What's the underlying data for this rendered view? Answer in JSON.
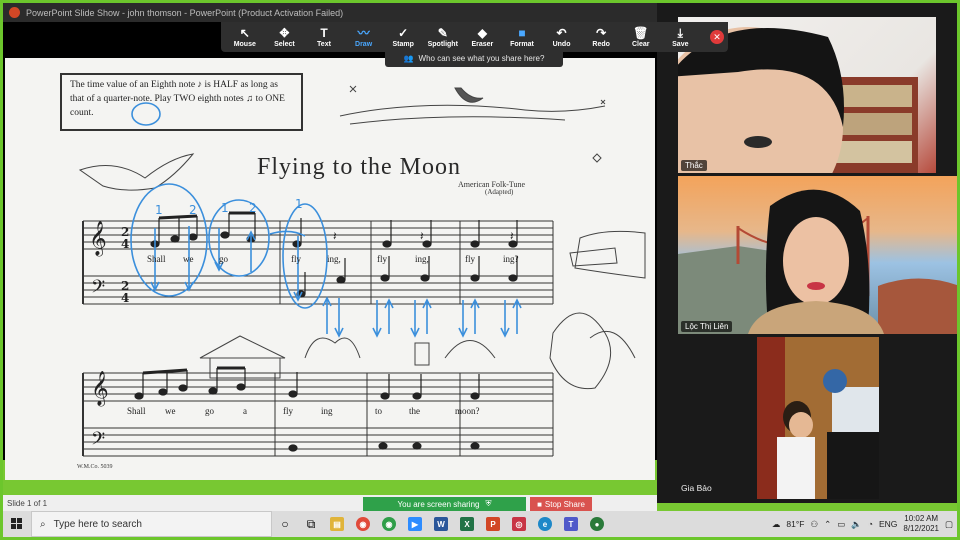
{
  "title_bar": {
    "text": "PowerPoint Slide Show  -  john thomson  -  PowerPoint (Product Activation Failed)"
  },
  "toolbar": {
    "items": [
      {
        "label": "Mouse",
        "icon": "cursor-icon",
        "glyph": "↖"
      },
      {
        "label": "Select",
        "icon": "move-icon",
        "glyph": "✥"
      },
      {
        "label": "Text",
        "icon": "text-icon",
        "glyph": "T"
      },
      {
        "label": "Draw",
        "icon": "draw-icon",
        "glyph": "〰",
        "active": true
      },
      {
        "label": "Stamp",
        "icon": "check-icon",
        "glyph": "✓"
      },
      {
        "label": "Spotlight",
        "icon": "spotlight-icon",
        "glyph": "✎"
      },
      {
        "label": "Eraser",
        "icon": "eraser-icon",
        "glyph": "◆"
      },
      {
        "label": "Format",
        "icon": "format-icon",
        "glyph": "■"
      },
      {
        "label": "Undo",
        "icon": "undo-icon",
        "glyph": "↶"
      },
      {
        "label": "Redo",
        "icon": "redo-icon",
        "glyph": "↷"
      },
      {
        "label": "Clear",
        "icon": "trash-icon",
        "glyph": "🗑"
      },
      {
        "label": "Save",
        "icon": "save-icon",
        "glyph": "⤓"
      }
    ],
    "close_glyph": "✕",
    "who_can_see": "Who can see what you share here?"
  },
  "slide": {
    "note_text": "The time value of an Eighth note ♪ is HALF as long as that of a quarter-note. Play TWO eighth notes ♫ to ONE count.",
    "music_title": "Flying to the Moon",
    "subtitle": "American Folk-Tune",
    "adapted": "(Adapted)",
    "lyrics_line1": [
      "Shall",
      "we",
      "go",
      "fly",
      "ing,",
      "fly",
      "ing,",
      "fly",
      "ing?"
    ],
    "lyrics_line2": [
      "Shall",
      "we",
      "go",
      "a",
      "fly",
      "ing",
      "to",
      "the",
      "moon?"
    ],
    "publisher": "W.M.Co. 5039"
  },
  "status": {
    "slide_count": "Slide 1 of 1",
    "sharing": "You are screen sharing",
    "stop_share": "Stop Share"
  },
  "participants": [
    {
      "name": "Thắc",
      "tile": "top"
    },
    {
      "name": "Lộc Thị Liên",
      "tile": "middle"
    },
    {
      "name": "Gia Bảo",
      "tile": "bottom"
    }
  ],
  "taskbar": {
    "search_placeholder": "Type here to search",
    "temperature": "81°F",
    "language": "ENG",
    "time": "10:02 AM",
    "date": "8/12/2021"
  },
  "colors": {
    "share_border": "#6cc62c",
    "annotation_blue": "#3b8fdc",
    "stop_red": "#d9534f",
    "share_green": "#2fa14a"
  }
}
